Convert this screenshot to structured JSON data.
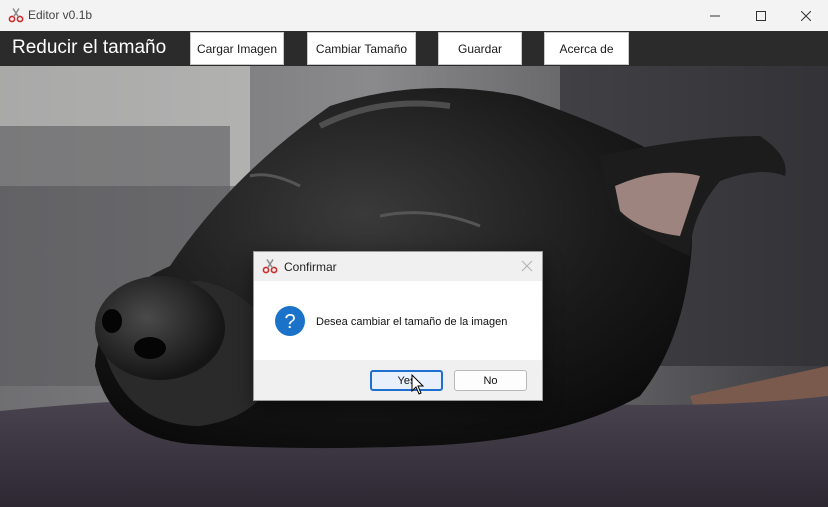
{
  "window": {
    "title": "Editor v0.1b",
    "icon": "scissors-icon"
  },
  "toolbar": {
    "heading": "Reducir el tamaño",
    "buttons": {
      "load": "Cargar Imagen",
      "resize": "Cambiar Tamaño",
      "save": "Guardar",
      "about": "Acerca de"
    }
  },
  "canvas": {
    "image": "photo of a black dog resting its head on a grey cushion"
  },
  "dialog": {
    "title": "Confirmar",
    "icon": "question-icon",
    "message": "Desea cambiar el tamaño de la imagen",
    "buttons": {
      "yes": "Yes",
      "no": "No"
    }
  },
  "colors": {
    "titlebar": "#f3f3f3",
    "toolbar": "#2b2b2b",
    "accent": "#1f6fd1",
    "question_icon": "#1a73c9"
  }
}
